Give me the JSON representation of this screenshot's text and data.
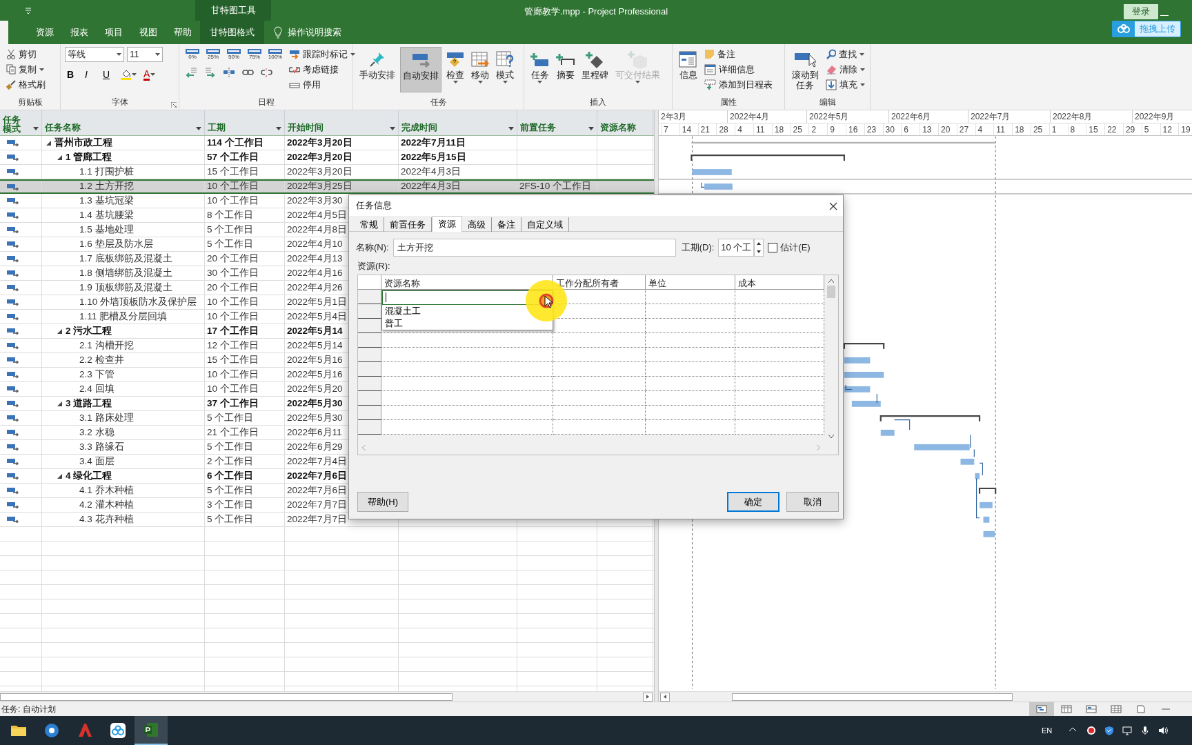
{
  "window": {
    "title": "管廊教学.mpp  -  Project Professional",
    "context_group": "甘特图工具",
    "login_button": "登录",
    "upload_button": "拖拽上传"
  },
  "ribbon_tabs": [
    {
      "label": "资源",
      "selected": false,
      "contextual": false
    },
    {
      "label": "报表",
      "selected": false,
      "contextual": false
    },
    {
      "label": "项目",
      "selected": false,
      "contextual": false
    },
    {
      "label": "视图",
      "selected": false,
      "contextual": false
    },
    {
      "label": "帮助",
      "selected": false,
      "contextual": false
    },
    {
      "label": "甘特图格式",
      "selected": false,
      "contextual": true
    }
  ],
  "tell_me": "操作说明搜索",
  "ribbon_groups": [
    {
      "label": "剪贴板",
      "items": [
        {
          "kind": "small",
          "label": "剪切"
        },
        {
          "kind": "small",
          "label": "复制",
          "caret": true
        },
        {
          "kind": "small",
          "label": "格式刷"
        }
      ]
    },
    {
      "label": "字体",
      "launcher": true,
      "items": [
        {
          "kind": "combo",
          "value": "等线"
        },
        {
          "kind": "combo",
          "value": "11"
        },
        {
          "kind": "tool",
          "label": "B"
        },
        {
          "kind": "tool",
          "label": "I"
        },
        {
          "kind": "tool",
          "label": "U"
        },
        {
          "kind": "tool",
          "color": "#ffe100",
          "caret": true
        },
        {
          "kind": "tool",
          "label": "A",
          "color": "#c00000",
          "caret": true
        }
      ]
    },
    {
      "label": "日程",
      "items": [
        {
          "kind": "pct",
          "label": "0%"
        },
        {
          "kind": "pct",
          "label": "25%"
        },
        {
          "kind": "pct",
          "label": "50%"
        },
        {
          "kind": "pct",
          "label": "75%"
        },
        {
          "kind": "pct",
          "label": "100%"
        },
        {
          "kind": "tool"
        },
        {
          "kind": "tool"
        },
        {
          "kind": "tool"
        },
        {
          "kind": "tool"
        },
        {
          "kind": "tool"
        },
        {
          "kind": "small",
          "label": "跟踪时标记",
          "caret": true
        },
        {
          "kind": "small",
          "label": "考虑链接"
        },
        {
          "kind": "small",
          "label": "停用"
        }
      ]
    },
    {
      "label": "任务",
      "items": [
        {
          "kind": "large",
          "label": "手动安排",
          "selected": false
        },
        {
          "kind": "large",
          "label": "自动安排",
          "selected": true
        },
        {
          "kind": "large",
          "label": "检查",
          "caret": true,
          "selected": false
        },
        {
          "kind": "large",
          "label": "移动",
          "caret": true,
          "selected": false
        },
        {
          "kind": "large",
          "label": "模式",
          "caret": true,
          "selected": false
        }
      ]
    },
    {
      "label": "插入",
      "items": [
        {
          "kind": "large",
          "label": "任务",
          "caret": true,
          "disabled": false
        },
        {
          "kind": "large",
          "label": "摘要",
          "disabled": false
        },
        {
          "kind": "large",
          "label": "里程碑",
          "disabled": false
        },
        {
          "kind": "large",
          "label": "可交付结果",
          "caret": true,
          "disabled": true
        }
      ]
    },
    {
      "label": "属性",
      "items": [
        {
          "kind": "large",
          "label": "信息"
        },
        {
          "kind": "small",
          "label": "备注"
        },
        {
          "kind": "small",
          "label": "详细信息"
        },
        {
          "kind": "small",
          "label": "添加到日程表"
        }
      ]
    },
    {
      "label": "编辑",
      "items": [
        {
          "kind": "large",
          "label": "滚动到任务"
        },
        {
          "kind": "small",
          "label": "查找",
          "caret": true
        },
        {
          "kind": "small",
          "label": "清除",
          "caret": true
        },
        {
          "kind": "small",
          "label": "填充",
          "caret": true
        }
      ]
    }
  ],
  "table": {
    "columns": [
      {
        "label": "任务模式",
        "menu": true
      },
      {
        "label": "任务名称",
        "menu": true
      },
      {
        "label": "工期",
        "menu": true
      },
      {
        "label": "开始时间",
        "menu": true
      },
      {
        "label": "完成时间",
        "menu": true
      },
      {
        "label": "前置任务",
        "menu": true
      },
      {
        "label": "资源名称",
        "menu": false
      }
    ],
    "tasks": [
      {
        "name": "晋州市政工程",
        "duration": "114 个工作日",
        "start": "2022年3月20日",
        "finish": "2022年7月11日",
        "selected": false,
        "expanded": true,
        "children": [
          {
            "name": "1 管廊工程",
            "duration": "57 个工作日",
            "start": "2022年3月20日",
            "finish": "2022年5月15日",
            "selected": false,
            "expanded": true,
            "children": [
              {
                "name": "1.1 打围护桩",
                "duration": "15 个工作日",
                "start": "2022年3月20日",
                "finish": "2022年4月3日",
                "selected": false
              },
              {
                "name": "1.2 土方开挖",
                "duration": "10 个工作日",
                "start": "2022年3月25日",
                "finish": "2022年4月3日",
                "predecessors": "2FS-10 个工作日",
                "selected": true
              },
              {
                "name": "1.3 基坑冠梁",
                "duration": "10 个工作日",
                "start": "2022年3月30",
                "selected": false
              },
              {
                "name": "1.4 基坑腰梁",
                "duration": "8 个工作日",
                "start": "2022年4月5日",
                "selected": false
              },
              {
                "name": "1.5 基地处理",
                "duration": "5 个工作日",
                "start": "2022年4月8日",
                "selected": false
              },
              {
                "name": "1.6 垫层及防水层",
                "duration": "5 个工作日",
                "start": "2022年4月10",
                "selected": false
              },
              {
                "name": "1.7 底板绑筋及混凝土",
                "duration": "20 个工作日",
                "start": "2022年4月13",
                "selected": false
              },
              {
                "name": "1.8 侧墙绑筋及混凝土",
                "duration": "30 个工作日",
                "start": "2022年4月16",
                "selected": false
              },
              {
                "name": "1.9 顶板绑筋及混凝土",
                "duration": "20 个工作日",
                "start": "2022年4月26",
                "selected": false
              },
              {
                "name": "1.10 外墙顶板防水及保护层",
                "duration": "10 个工作日",
                "start": "2022年5月1日",
                "selected": false
              },
              {
                "name": "1.11 肥槽及分层回填",
                "duration": "10 个工作日",
                "start": "2022年5月4日",
                "selected": false
              }
            ]
          },
          {
            "name": "2 污水工程",
            "duration": "17 个工作日",
            "start": "2022年5月14",
            "selected": false,
            "expanded": true,
            "children": [
              {
                "name": "2.1 沟槽开挖",
                "duration": "12 个工作日",
                "start": "2022年5月14",
                "selected": false
              },
              {
                "name": "2.2 检查井",
                "duration": "15 个工作日",
                "start": "2022年5月16",
                "selected": false
              },
              {
                "name": "2.3 下管",
                "duration": "10 个工作日",
                "start": "2022年5月16",
                "selected": false
              },
              {
                "name": "2.4 回填",
                "duration": "10 个工作日",
                "start": "2022年5月20",
                "selected": false
              }
            ]
          },
          {
            "name": "3 道路工程",
            "duration": "37 个工作日",
            "start": "2022年5月30",
            "selected": false,
            "expanded": true,
            "children": [
              {
                "name": "3.1 路床处理",
                "duration": "5 个工作日",
                "start": "2022年5月30",
                "selected": false
              },
              {
                "name": "3.2 水稳",
                "duration": "21 个工作日",
                "start": "2022年6月11",
                "selected": false
              },
              {
                "name": "3.3 路缘石",
                "duration": "5 个工作日",
                "start": "2022年6月29",
                "selected": false
              },
              {
                "name": "3.4 面层",
                "duration": "2 个工作日",
                "start": "2022年7月4日",
                "selected": false
              }
            ]
          },
          {
            "name": "4 绿化工程",
            "duration": "6 个工作日",
            "start": "2022年7月6日",
            "selected": false,
            "expanded": true,
            "children": [
              {
                "name": "4.1 乔木种植",
                "duration": "5 个工作日",
                "start": "2022年7月6日",
                "selected": false
              },
              {
                "name": "4.2 灌木种植",
                "duration": "3 个工作日",
                "start": "2022年7月7日",
                "selected": false
              },
              {
                "name": "4.3 花卉种植",
                "duration": "5 个工作日",
                "start": "2022年7月7日",
                "selected": false
              }
            ]
          }
        ]
      }
    ]
  },
  "gantt": {
    "months": [
      "2年3月",
      "2022年4月",
      "2022年5月",
      "2022年6月",
      "2022年7月",
      "2022年8月",
      "2022年9月"
    ],
    "days": [
      "7",
      "14",
      "21",
      "28",
      "4",
      "11",
      "18",
      "25",
      "2",
      "9",
      "16",
      "23",
      "30",
      "6",
      "13",
      "20",
      "27",
      "4",
      "11",
      "18",
      "25",
      "1",
      "8",
      "15",
      "22",
      "29",
      "5",
      "12",
      "19"
    ]
  },
  "dialog": {
    "title": "任务信息",
    "tabs": [
      {
        "label": "常规",
        "selected": false
      },
      {
        "label": "前置任务",
        "selected": false
      },
      {
        "label": "资源",
        "selected": true
      },
      {
        "label": "高级",
        "selected": false
      },
      {
        "label": "备注",
        "selected": false
      },
      {
        "label": "自定义域",
        "selected": false
      }
    ],
    "name_label": "名称(N):",
    "name_value": "土方开挖",
    "duration_label": "工期(D):",
    "duration_value": "10 个工",
    "estimate": {
      "label": "估计(E)",
      "checked": false
    },
    "resources_label": "资源(R):",
    "grid_columns": [
      "资源名称",
      "工作分配所有者",
      "单位",
      "成本"
    ],
    "dropdown": {
      "expanded": true,
      "options": [
        "混凝土工",
        "普工"
      ]
    },
    "buttons": [
      {
        "label": "帮助(H)",
        "default": false
      },
      {
        "label": "确定",
        "default": true
      },
      {
        "label": "取消",
        "default": false
      }
    ]
  },
  "status_bar": {
    "text": "任务: 自动计划"
  },
  "taskbar": {
    "apps": [
      {
        "active": false
      },
      {
        "active": false
      },
      {
        "active": false
      },
      {
        "active": false
      },
      {
        "active": true
      }
    ],
    "language": "EN"
  }
}
